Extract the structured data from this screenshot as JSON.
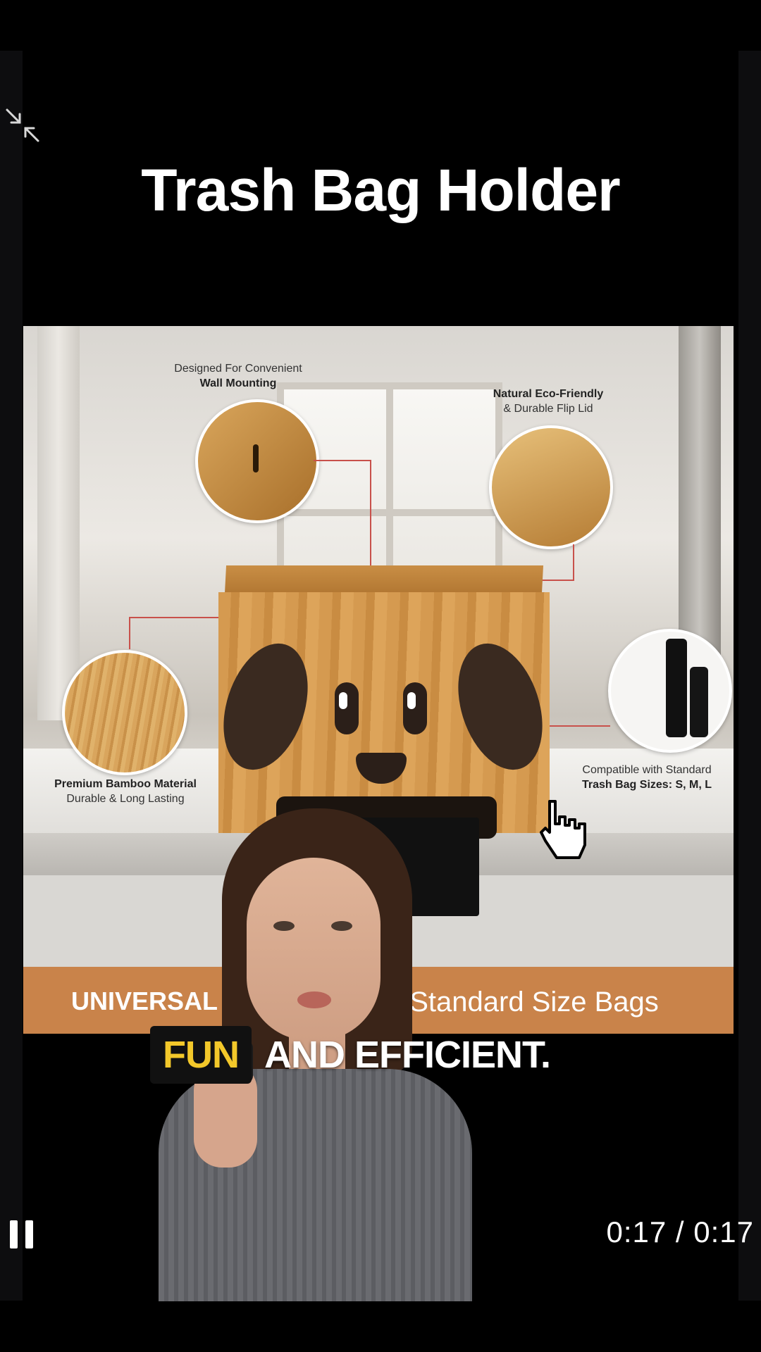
{
  "video": {
    "title": "Trash Bag Holder",
    "time_display": "0:17 / 0:17",
    "caption_highlight": "FUN",
    "caption_rest": "AND EFFICIENT."
  },
  "ad": {
    "callout_wall_line1": "Designed For Convenient",
    "callout_wall_line2": "Wall Mounting",
    "callout_lid_line1": "Natural Eco-Friendly",
    "callout_lid_line2": "& Durable Flip Lid",
    "callout_bamboo_line1": "Premium Bamboo Material",
    "callout_bamboo_line2": "Durable & Long Lasting",
    "callout_compat_line1": "Compatible with Standard",
    "callout_compat_line2": "Trash Bag Sizes: S, M, L",
    "banner_left": "UNIVERSAL",
    "banner_right": "st Standard Size Bags"
  },
  "colors": {
    "caption_highlight": "#f3c82a",
    "banner": "#c9834a",
    "callout_line": "#c8514b"
  },
  "icons": {
    "minimize": "minimize-icon",
    "pause": "pause-icon",
    "cursor": "hand-cursor-icon"
  }
}
